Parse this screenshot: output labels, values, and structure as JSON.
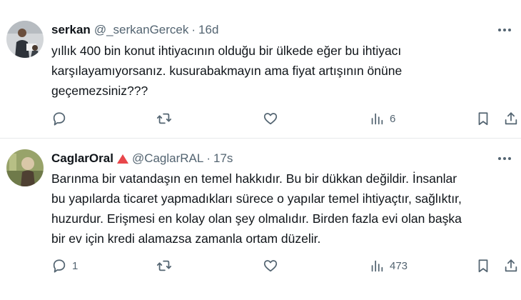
{
  "tweets": [
    {
      "display_name": "serkan",
      "handle": "@_serkanGercek",
      "separator": "·",
      "time": "16d",
      "body_lines": [
        "yıllık 400 bin konut ihtiyacının olduğu bir ülkede eğer bu ihtiyacı",
        "karşılayamıyorsanız. kusurabakmayın ama fiyat artışının önüne",
        "geçemezsiniz???"
      ],
      "counts": {
        "replies": "",
        "reposts": "",
        "likes": "",
        "views": "6"
      },
      "avatar": {
        "bg": "#c9cdd1",
        "figure": "#3a3f46"
      }
    },
    {
      "display_name": "CaglarOral",
      "handle": "@CaglarRAL",
      "separator": "·",
      "time": "17s",
      "badge_color": "#e8474b",
      "body_lines": [
        "Barınma bir vatandaşın en temel hakkıdır. Bu bir dükkan değildir. İnsanlar",
        "bu yapılarda ticaret yapmadıkları sürece o yapılar temel ihtiyaçtır, sağlıktır,",
        "huzurdur. Erişmesi en kolay olan şey olmalıdır. Birden fazla evi olan başka",
        "bir ev için kredi alamazsa zamanla ortam düzelir."
      ],
      "counts": {
        "replies": "1",
        "reposts": "",
        "likes": "",
        "views": "473"
      },
      "avatar": {
        "bg": "#8f9a63",
        "figure": "#5a4a3a"
      }
    }
  ],
  "icons": [
    "reply-icon",
    "repost-icon",
    "like-icon",
    "views-icon",
    "bookmark-icon",
    "share-icon",
    "more-icon"
  ],
  "colors": {
    "text": "#0f1419",
    "secondary": "#536471",
    "divider": "#e7e9ea"
  }
}
